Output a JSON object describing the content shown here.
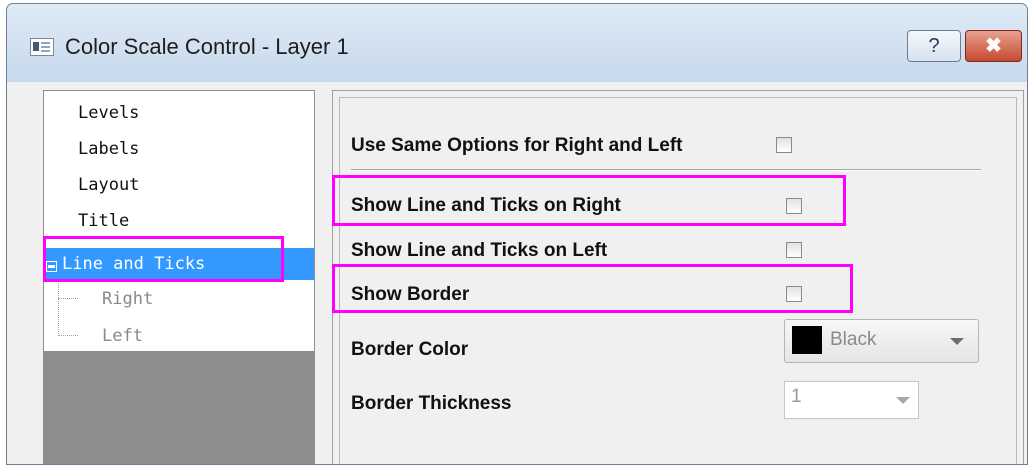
{
  "window": {
    "title": "Color Scale Control - Layer 1",
    "help_label": "?",
    "close_label": "✖"
  },
  "tree": {
    "items": [
      "Levels",
      "Labels",
      "Layout",
      "Title"
    ],
    "selected": "Line and Ticks",
    "children": [
      "Right",
      "Left"
    ]
  },
  "options": {
    "same_options_label": "Use Same Options for Right and Left",
    "ticks_right_label": "Show Line and Ticks on Right",
    "ticks_left_label": "Show Line and Ticks on Left",
    "show_border_label": "Show Border",
    "border_color_label": "Border Color",
    "border_color_value": "Black",
    "border_thickness_label": "Border Thickness",
    "border_thickness_value": "1"
  },
  "colors": {
    "selection": "#3399ff",
    "highlight": "#ff00ff",
    "swatch": "#000000"
  }
}
